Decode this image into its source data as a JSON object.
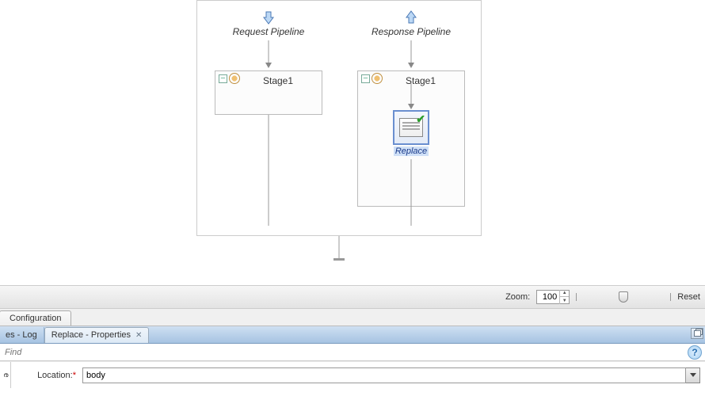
{
  "pipelines": {
    "request": {
      "label": "Request Pipeline",
      "stage_title": "Stage1"
    },
    "response": {
      "label": "Response Pipeline",
      "stage_title": "Stage1",
      "action_label": "Replace"
    }
  },
  "zoom": {
    "label": "Zoom:",
    "value": "100",
    "reset": "Reset",
    "thumb_percent": 50
  },
  "outer_tab": {
    "configuration": "Configuration"
  },
  "inner_tabs": {
    "log": "es - Log",
    "replace_properties": "Replace - Properties"
  },
  "find": {
    "placeholder": "Find"
  },
  "properties": {
    "side_label": "e",
    "location_label": "Location:",
    "location_value": "body"
  },
  "icons": {
    "help": "?"
  }
}
